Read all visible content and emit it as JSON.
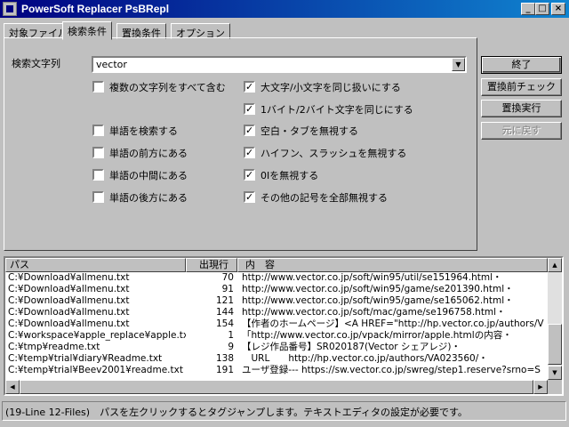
{
  "window": {
    "title": "PowerSoft Replacer PsBRepl",
    "minimize": "_",
    "maximize": "□",
    "close": "×"
  },
  "tabs": [
    "対象ファイル",
    "検索条件",
    "置換条件",
    "オプション"
  ],
  "search": {
    "label": "検索文字列",
    "value": "vector"
  },
  "options_left": [
    {
      "label": "複数の文字列をすべて含む",
      "checked": false
    },
    {
      "label": "単語を検索する",
      "checked": false
    },
    {
      "label": "単語の前方にある",
      "checked": false
    },
    {
      "label": "単語の中間にある",
      "checked": false
    },
    {
      "label": "単語の後方にある",
      "checked": false
    }
  ],
  "options_right": [
    {
      "label": "大文字/小文字を同じ扱いにする",
      "checked": true
    },
    {
      "label": "1バイト/2バイト文字を同じにする",
      "checked": true
    },
    {
      "label": "空白・タブを無視する",
      "checked": true
    },
    {
      "label": "ハイフン、スラッシュを無視する",
      "checked": true
    },
    {
      "label": "0Iを無視する",
      "checked": true
    },
    {
      "label": "その他の記号を全部無視する",
      "checked": true
    }
  ],
  "buttons": {
    "close": "終了",
    "preview": "置換前チェック",
    "execute": "置換実行",
    "undo": "元に戻す"
  },
  "results": {
    "headers": {
      "path": "パス",
      "line": "出現行",
      "content": "内　容"
    },
    "rows": [
      {
        "path": "C:¥Download¥allmenu.txt",
        "line": "70",
        "content": "http://www.vector.co.jp/soft/win95/util/se151964.html・"
      },
      {
        "path": "C:¥Download¥allmenu.txt",
        "line": "91",
        "content": "http://www.vector.co.jp/soft/win95/game/se201390.html・"
      },
      {
        "path": "C:¥Download¥allmenu.txt",
        "line": "121",
        "content": "http://www.vector.co.jp/soft/win95/game/se165062.html・"
      },
      {
        "path": "C:¥Download¥allmenu.txt",
        "line": "144",
        "content": "http://www.vector.co.jp/soft/mac/game/se196758.html・"
      },
      {
        "path": "C:¥Download¥allmenu.txt",
        "line": "154",
        "content": "【作者のホームページ】<A HREF=\"http://hp.vector.co.jp/authors/V"
      },
      {
        "path": "C:¥workspace¥apple_replace¥apple.txt",
        "line": "1",
        "content": "「http://www.vector.co.jp/vpack/mirror/apple.htmlの内容・"
      },
      {
        "path": "C:¥tmp¥readme.txt",
        "line": "9",
        "content": "【レジ作品番号】SR020187(Vector シェアレジ)・"
      },
      {
        "path": "C:¥temp¥trial¥diary¥Readme.txt",
        "line": "138",
        "content": "　URL　　http://hp.vector.co.jp/authors/VA023560/・"
      },
      {
        "path": "C:¥temp¥trial¥Beev2001¥readme.txt",
        "line": "191",
        "content": "ユーザ登録--- https://sw.vector.co.jp/swreg/step1.reserve?srno=S"
      }
    ]
  },
  "status": "(19-Line 12-Files)　パスを左クリックするとタグジャンプします。テキストエディタの設定が必要です。"
}
